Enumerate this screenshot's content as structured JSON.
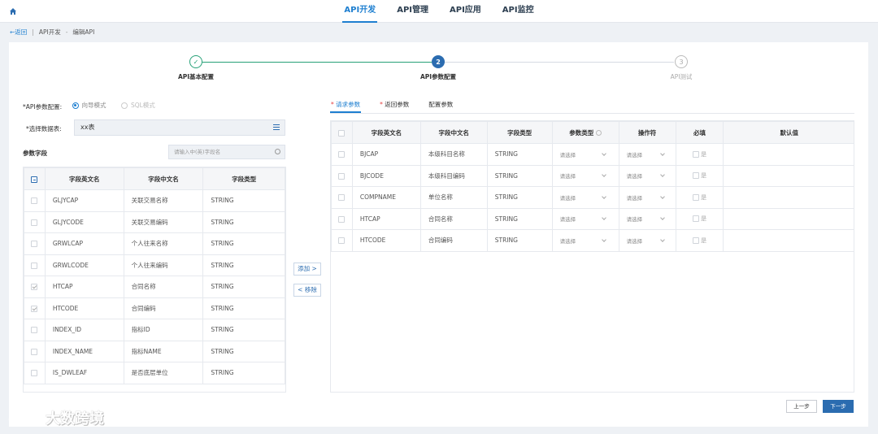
{
  "topnav": {
    "items": [
      {
        "label": "API开发",
        "active": true
      },
      {
        "label": "API管理",
        "active": false
      },
      {
        "label": "API应用",
        "active": false
      },
      {
        "label": "API监控",
        "active": false
      }
    ]
  },
  "breadcrumb": {
    "back": "←返回",
    "sep": "|",
    "level1": "API开发",
    "arrow": "-",
    "level2": "编辑API"
  },
  "steps": [
    {
      "label": "API基本配置",
      "state": "done",
      "marker": "✓"
    },
    {
      "label": "API参数配置",
      "state": "current",
      "marker": "2"
    },
    {
      "label": "API测试",
      "state": "todo",
      "marker": "3"
    }
  ],
  "left": {
    "param_config_label": "*API参数配置:",
    "mode_guide": "向导模式",
    "mode_sql": "SQL模式",
    "select_table_label": "*选择数据表:",
    "selected_table": "xx表",
    "param_field_label": "参数字段",
    "search_placeholder": "请输入中(英)字段名",
    "table_headers": [
      "字段英文名",
      "字段中文名",
      "字段类型"
    ],
    "rows": [
      {
        "checked": false,
        "en": "GLJYCAP",
        "cn": "关联交易名称",
        "type": "STRING"
      },
      {
        "checked": false,
        "en": "GLJYCODE",
        "cn": "关联交易编码",
        "type": "STRING"
      },
      {
        "checked": false,
        "en": "GRWLCAP",
        "cn": "个人往来名称",
        "type": "STRING"
      },
      {
        "checked": false,
        "en": "GRWLCODE",
        "cn": "个人往来编码",
        "type": "STRING"
      },
      {
        "checked": true,
        "en": "HTCAP",
        "cn": "合同名称",
        "type": "STRING"
      },
      {
        "checked": true,
        "en": "HTCODE",
        "cn": "合同编码",
        "type": "STRING"
      },
      {
        "checked": false,
        "en": "INDEX_ID",
        "cn": "指标ID",
        "type": "STRING"
      },
      {
        "checked": false,
        "en": "INDEX_NAME",
        "cn": "指标NAME",
        "type": "STRING"
      },
      {
        "checked": false,
        "en": "IS_DWLEAF",
        "cn": "是否底层单位",
        "type": "STRING"
      }
    ]
  },
  "middle": {
    "add": "添加 >",
    "remove": "< 移除"
  },
  "right": {
    "tabs": [
      {
        "label": "请求参数",
        "required": true,
        "active": true
      },
      {
        "label": "返回参数",
        "required": true,
        "active": false
      },
      {
        "label": "配置参数",
        "required": false,
        "active": false
      }
    ],
    "table_headers": [
      "字段英文名",
      "字段中文名",
      "字段类型",
      "参数类型",
      "操作符",
      "必填",
      "默认值"
    ],
    "select_placeholder": "请选择",
    "required_text": "是",
    "rows": [
      {
        "en": "BJCAP",
        "cn": "本级科目名称",
        "type": "STRING"
      },
      {
        "en": "BJCODE",
        "cn": "本级科目编码",
        "type": "STRING"
      },
      {
        "en": "COMPNAME",
        "cn": "单位名称",
        "type": "STRING"
      },
      {
        "en": "HTCAP",
        "cn": "合同名称",
        "type": "STRING"
      },
      {
        "en": "HTCODE",
        "cn": "合同编码",
        "type": "STRING"
      }
    ]
  },
  "footer": {
    "prev": "上一步",
    "next": "下一步"
  },
  "watermark": {
    "text": "大数跨境"
  },
  "colors": {
    "primary": "#2b6cb0",
    "link": "#1e7fd0",
    "done": "#27a178"
  }
}
